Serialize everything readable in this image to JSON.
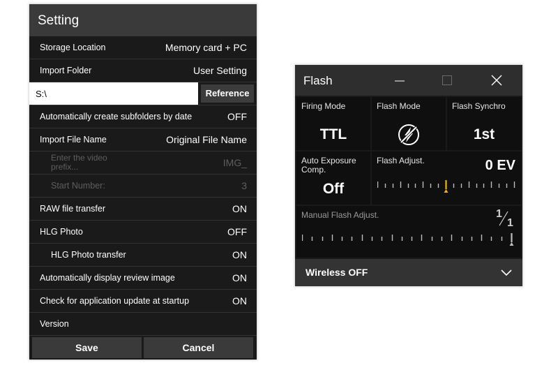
{
  "setting": {
    "title": "Setting",
    "rows": {
      "storage": {
        "label": "Storage Location",
        "value": "Memory card + PC"
      },
      "import_folder": {
        "label": "Import Folder",
        "value": "User Setting"
      },
      "folder_path": {
        "value": "S:\\",
        "button": "Reference"
      },
      "subfolders": {
        "label": "Automatically create subfolders by date",
        "value": "OFF"
      },
      "file_name": {
        "label": "Import File Name",
        "value": "Original File Name"
      },
      "video_prefix": {
        "label": "Enter the video prefix...",
        "value": "IMG_"
      },
      "start_number": {
        "label": "Start Number:",
        "value": "3"
      },
      "raw_transfer": {
        "label": "RAW file transfer",
        "value": "ON"
      },
      "hlg_photo": {
        "label": "HLG Photo",
        "value": "OFF"
      },
      "hlg_transfer": {
        "label": "HLG Photo transfer",
        "value": "ON"
      },
      "review": {
        "label": "Automatically display review image",
        "value": "ON"
      },
      "update": {
        "label": "Check for application update at startup",
        "value": "ON"
      },
      "version": {
        "label": "Version",
        "value": ""
      }
    },
    "buttons": {
      "save": "Save",
      "cancel": "Cancel"
    }
  },
  "flash": {
    "title": "Flash",
    "window_icons": [
      "minimize-icon",
      "maximize-icon",
      "close-icon"
    ],
    "firing_mode": {
      "label": "Firing Mode",
      "value": "TTL"
    },
    "flash_mode": {
      "label": "Flash Mode",
      "icon": "flash-no-flash-icon"
    },
    "flash_synchro": {
      "label": "Flash Synchro",
      "value": "1st"
    },
    "auto_exposure": {
      "label": "Auto Exposure Comp.",
      "value": "Off"
    },
    "flash_adjust": {
      "label": "Flash Adjust.",
      "value": "0 EV",
      "level": 0.5
    },
    "manual_adjust": {
      "label": "Manual Flash Adjust.",
      "numerator": "1",
      "denominator": "1",
      "level": 1.0
    },
    "wireless": {
      "label": "Wireless OFF",
      "icon": "chevron-down-icon"
    },
    "colors": {
      "accent": "#f0b400",
      "panel": "#1a1a1a",
      "cell": "#0f0f0f"
    }
  }
}
